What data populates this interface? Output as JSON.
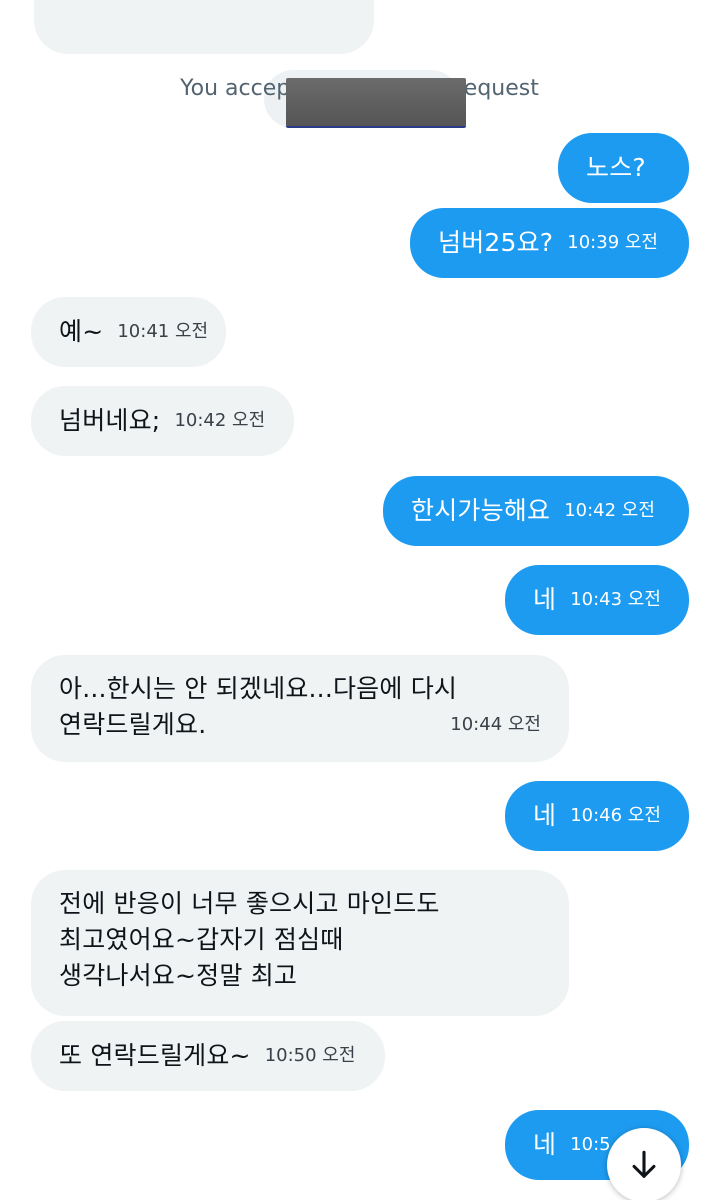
{
  "notice": {
    "text": "You accepted [redacted] request"
  },
  "messages": [
    {
      "direction": "in",
      "text": "",
      "time": ""
    },
    {
      "direction": "out",
      "text": "노스?",
      "time": ""
    },
    {
      "direction": "out",
      "text": "넘버25요?",
      "time": "10:39 오전"
    },
    {
      "direction": "in",
      "text": "예~",
      "time": "10:41 오전"
    },
    {
      "direction": "in",
      "text": "넘버네요;",
      "time": "10:42 오전"
    },
    {
      "direction": "out",
      "text": "한시가능해요",
      "time": "10:42 오전"
    },
    {
      "direction": "out",
      "text": "네",
      "time": "10:43 오전"
    },
    {
      "direction": "in",
      "lines": [
        "아...한시는 안 되겠네요...다음에 다시",
        "연락드릴게요."
      ],
      "time": "10:44 오전"
    },
    {
      "direction": "out",
      "text": "네",
      "time": "10:46 오전"
    },
    {
      "direction": "in",
      "lines": [
        "전에 반응이 너무 좋으시고 마인드도",
        "최고였어요~갑자기 점심때",
        "생각나서요~정말 최고"
      ],
      "time": ""
    },
    {
      "direction": "in",
      "text": "또 연락드릴게요~",
      "time": "10:50 오전"
    },
    {
      "direction": "out",
      "text": "네",
      "time": "10:5"
    }
  ],
  "icons": {
    "scroll_down": "arrow-down-icon",
    "avatar": "avatar"
  },
  "colors": {
    "outgoing_bubble": "#1d9bf0",
    "incoming_bubble": "#eff3f4",
    "text_dark": "#0f1419",
    "notice_text": "#536471"
  }
}
